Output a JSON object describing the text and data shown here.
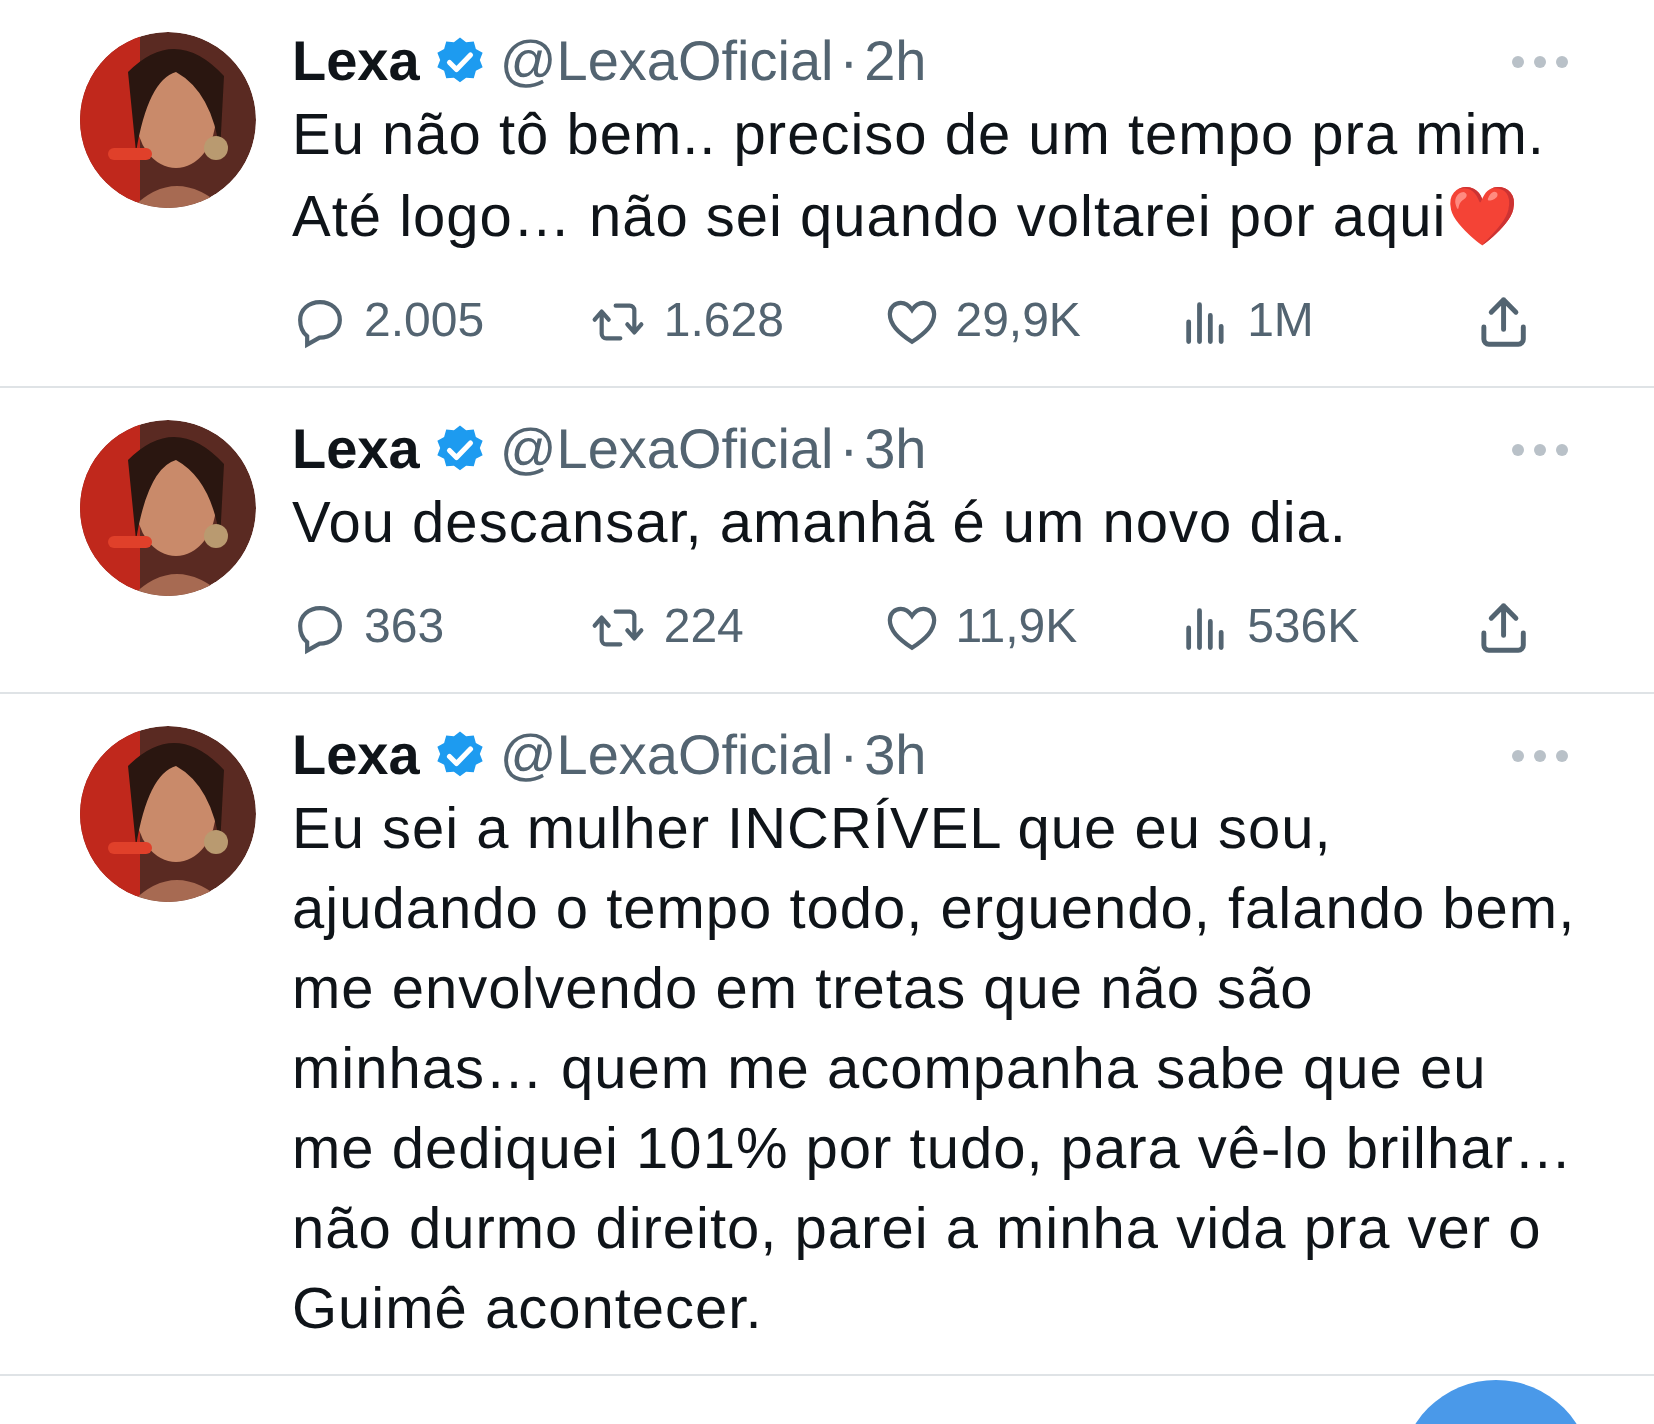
{
  "tweets": [
    {
      "name": "Lexa",
      "verified": true,
      "handle": "@LexaOficial",
      "separator": "·",
      "time": "2h",
      "text": "Eu não tô bem.. preciso de um tempo pra mim. Até logo… não sei quando voltarei por aqui",
      "emoji": "❤️",
      "replies": "2.005",
      "retweets": "1.628",
      "likes": "29,9K",
      "views": "1M"
    },
    {
      "name": "Lexa",
      "verified": true,
      "handle": "@LexaOficial",
      "separator": "·",
      "time": "3h",
      "text": "Vou descansar, amanhã é um novo dia.",
      "replies": "363",
      "retweets": "224",
      "likes": "11,9K",
      "views": "536K"
    },
    {
      "name": "Lexa",
      "verified": true,
      "handle": "@LexaOficial",
      "separator": "·",
      "time": "3h",
      "text": "Eu sei a mulher INCRÍVEL que eu sou, ajudando o tempo todo, erguendo, falando bem, me envolvendo em tretas que não são minhas… quem me acompanha sabe que eu me dediquei 101% por tudo, para vê-lo brilhar… não durmo direito, parei a minha vida pra ver o Guimê acontecer."
    }
  ]
}
